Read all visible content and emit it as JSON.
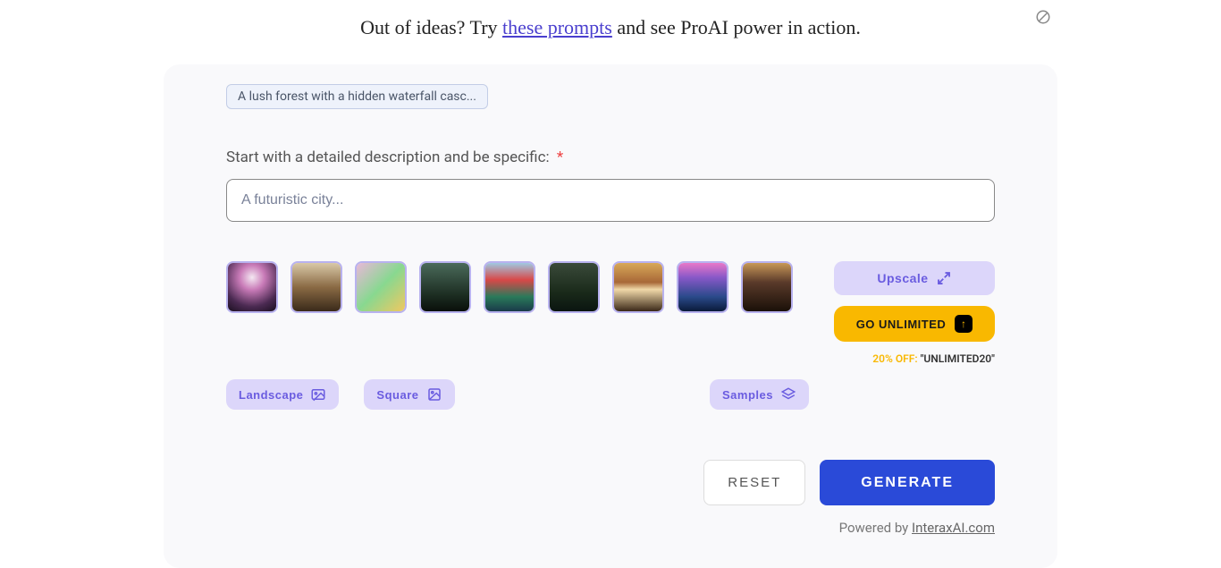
{
  "tagline": {
    "pre": "Out of ideas? Try ",
    "link": "these prompts",
    "post": " and see ProAI power in action."
  },
  "chip": "A lush forest with a hidden waterfall casc...",
  "prompt": {
    "label": "Start with a detailed description and be specific:",
    "required": "*",
    "placeholder": "A futuristic city..."
  },
  "thumbs": [
    {
      "name": "style-thumb-1"
    },
    {
      "name": "style-thumb-2"
    },
    {
      "name": "style-thumb-3"
    },
    {
      "name": "style-thumb-4"
    },
    {
      "name": "style-thumb-5"
    },
    {
      "name": "style-thumb-6"
    },
    {
      "name": "style-thumb-7"
    },
    {
      "name": "style-thumb-8"
    },
    {
      "name": "style-thumb-9"
    }
  ],
  "buttons": {
    "upscale": "Upscale",
    "landscape": "Landscape",
    "square": "Square",
    "samples": "Samples",
    "unlimited": "GO UNLIMITED",
    "reset": "RESET",
    "generate": "GENERATE"
  },
  "discount": {
    "pct": "20% OFF:",
    "code": "\"UNLIMITED20\""
  },
  "powered": {
    "pre": "Powered by ",
    "link": "InteraxAI.com"
  }
}
